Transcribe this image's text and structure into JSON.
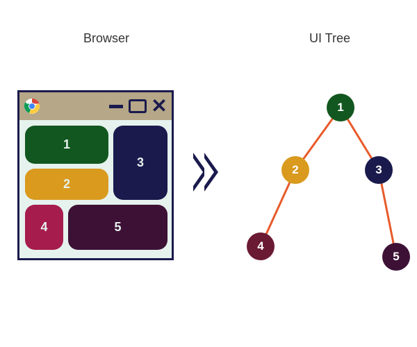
{
  "labels": {
    "browser": "Browser",
    "ui_tree": "UI Tree"
  },
  "browser_boxes": {
    "box1": "1",
    "box2": "2",
    "box3": "3",
    "box4": "4",
    "box5": "5"
  },
  "tree_nodes": {
    "n1": "1",
    "n2": "2",
    "n3": "3",
    "n4": "4",
    "n5": "5"
  },
  "colors": {
    "dark_green": "#12571f",
    "gold": "#d99a1e",
    "navy": "#1a1a4d",
    "crimson": "#a61c4d",
    "dark_purple": "#3d1136",
    "edge": "#e85a2a"
  },
  "tree_edges": [
    {
      "from": "1",
      "to": "2"
    },
    {
      "from": "1",
      "to": "3"
    },
    {
      "from": "2",
      "to": "4"
    },
    {
      "from": "3",
      "to": "5"
    }
  ]
}
